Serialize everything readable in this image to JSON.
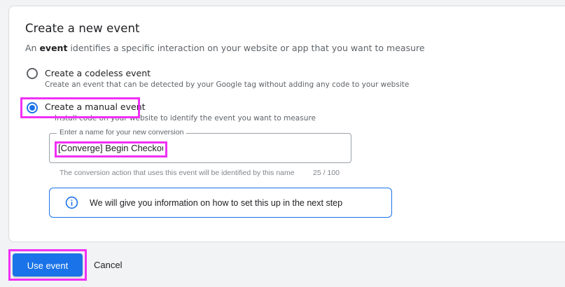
{
  "dialog": {
    "title": "Create a new event",
    "subtitle_bold": "event",
    "subtitle_before": "An ",
    "subtitle_after": " identifies a specific interaction on your website or app that you want to measure"
  },
  "options": [
    {
      "label": "Create a codeless event",
      "description": "Create an event that can be detected by your Google tag without adding any code to your website",
      "selected": false
    },
    {
      "label": "Create a manual event",
      "description": "Install code on your website to identify the event you want to measure",
      "selected": true
    }
  ],
  "name_field": {
    "label": "Enter a name for your new conversion",
    "value": "[Converge] Begin Checkout",
    "helper": "The conversion action that uses this event will be identified by this name",
    "counter": "25 / 100"
  },
  "info": {
    "icon": "info-icon",
    "text": "We will give you information on how to set this up in the next step",
    "color": "#1a73e8"
  },
  "actions": {
    "primary_label": "Use event",
    "cancel_label": "Cancel"
  },
  "colors": {
    "accent": "#1a73e8",
    "highlight": "#f02ff5"
  }
}
